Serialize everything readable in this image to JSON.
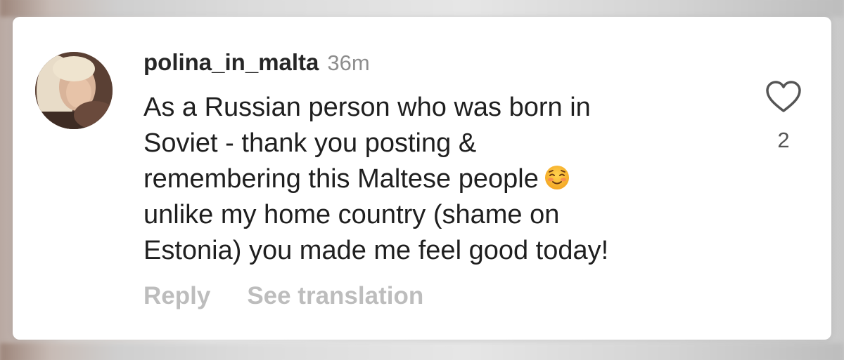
{
  "comment": {
    "username": "polina_in_malta",
    "time": "36m",
    "lines": [
      "As a Russian person who was born in",
      "Soviet - thank you posting &",
      "remembering this Maltese people",
      "unlike my home country (shame on",
      "Estonia) you made me feel good today!"
    ],
    "emoji": "smiling-face-with-blush",
    "like_count": "2"
  },
  "actions": {
    "reply_label": "Reply",
    "translate_label": "See translation"
  },
  "colors": {
    "username": "#262626",
    "muted": "#8e8e8e",
    "action": "#bdbdbd",
    "background_card": "#ffffff"
  }
}
